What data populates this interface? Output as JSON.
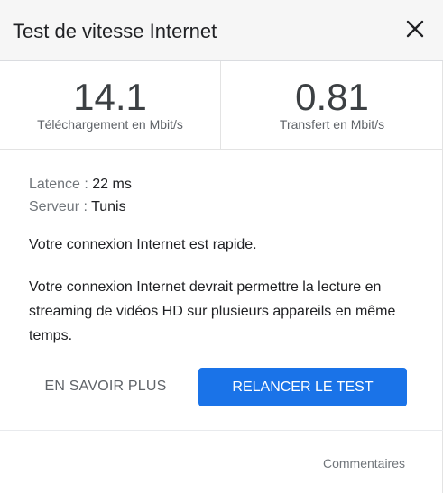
{
  "header": {
    "title": "Test de vitesse Internet",
    "close_icon": "close-icon"
  },
  "results": {
    "download": {
      "value": "14.1",
      "label": "Téléchargement en Mbit/s"
    },
    "upload": {
      "value": "0.81",
      "label": "Transfert en Mbit/s"
    }
  },
  "info": {
    "latency_label": "Latence :",
    "latency_value": "22 ms",
    "server_label": "Serveur :",
    "server_value": "Tunis"
  },
  "messages": {
    "summary": "Votre connexion Internet est rapide.",
    "detail": "Votre connexion Internet devrait permettre la lecture en streaming de vidéos HD sur plusieurs appareils en même temps."
  },
  "actions": {
    "learn_more": "EN SAVOIR PLUS",
    "retest": "RELANCER LE TEST"
  },
  "footer": {
    "feedback": "Commentaires"
  },
  "colors": {
    "accent": "#1a73e8",
    "header_bg": "#f6f6f6"
  }
}
